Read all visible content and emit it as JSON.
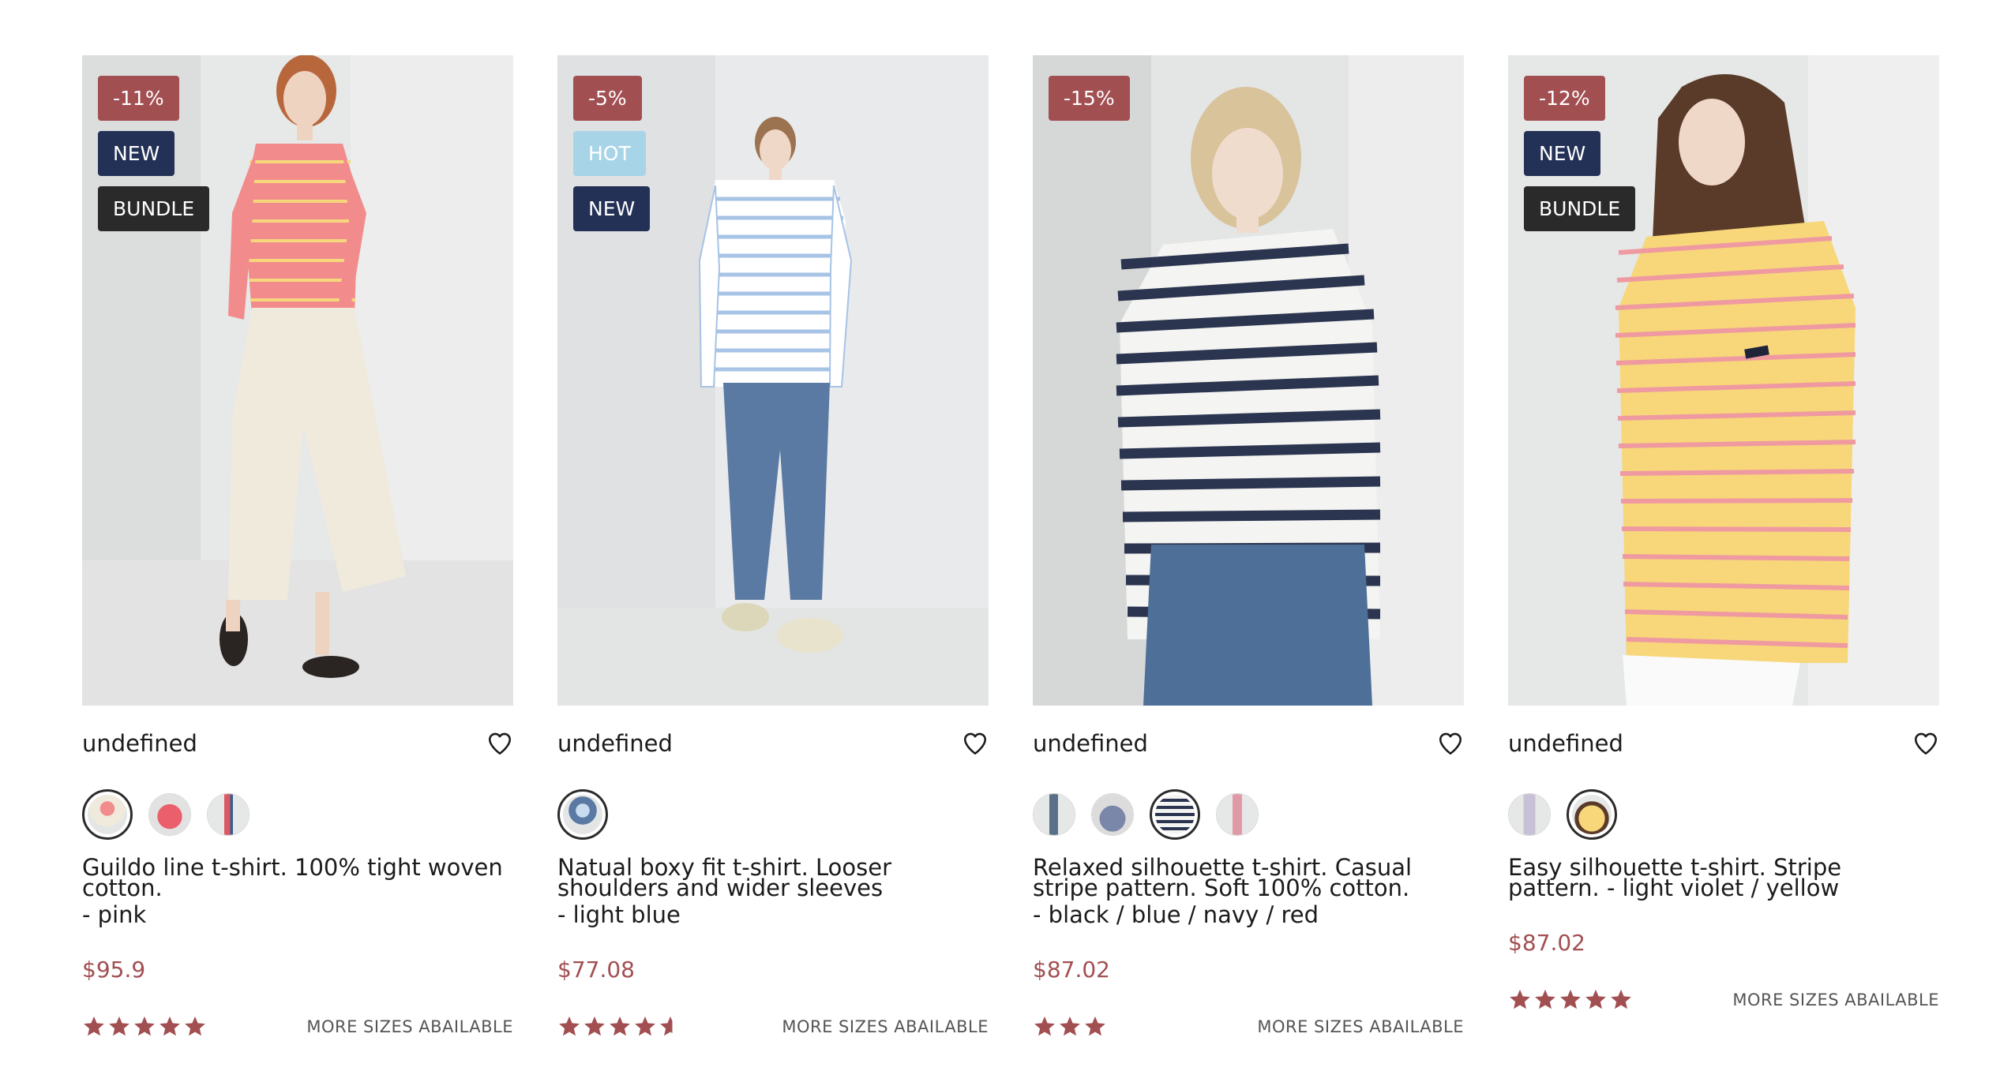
{
  "carousel": {
    "prev_icon": "chevron-left-icon",
    "next_icon": "chevron-right-icon"
  },
  "products": [
    {
      "badges": [
        {
          "type": "discount",
          "text": "-11%"
        },
        {
          "type": "new",
          "text": "NEW"
        },
        {
          "type": "bundle",
          "text": "BUNDLE"
        }
      ],
      "title": "undefined",
      "swatch_count": 3,
      "active_swatch": 0,
      "description": "Guildo line t-shirt. 100% tight woven cotton.",
      "variant": "- pink",
      "price": "$95.9",
      "rating": 5,
      "more_sizes": "MORE SIZES ABAILABLE",
      "shirt_color": "#f28c8c",
      "stripe_color": "#f6d77c"
    },
    {
      "badges": [
        {
          "type": "discount",
          "text": "-5%"
        },
        {
          "type": "hot",
          "text": "HOT"
        },
        {
          "type": "new",
          "text": "NEW"
        }
      ],
      "title": "undefined",
      "swatch_count": 1,
      "active_swatch": 0,
      "description": "Natual boxy fit t-shirt. Looser shoulders and wider sleeves",
      "variant": "- light blue",
      "price": "$77.08",
      "rating": 4.5,
      "more_sizes": "MORE SIZES ABAILABLE",
      "shirt_color": "#ffffff",
      "stripe_color": "#a7c3e6"
    },
    {
      "badges": [
        {
          "type": "discount",
          "text": "-15%"
        }
      ],
      "title": "undefined",
      "swatch_count": 4,
      "active_swatch": 2,
      "description": "Relaxed silhouette t-shirt. Casual stripe pattern. Soft 100% cotton.",
      "variant": "- black / blue / navy / red",
      "price": "$87.02",
      "rating": 3,
      "more_sizes": "MORE SIZES ABAILABLE",
      "shirt_color": "#f4f4f2",
      "stripe_color": "#2c3550"
    },
    {
      "badges": [
        {
          "type": "discount",
          "text": "-12%"
        },
        {
          "type": "new",
          "text": "NEW"
        },
        {
          "type": "bundle",
          "text": "BUNDLE"
        }
      ],
      "title": "undefined",
      "swatch_count": 2,
      "active_swatch": 1,
      "description": "Easy silhouette t-shirt. Stripe pattern. - light violet / yellow",
      "variant": "",
      "price": "$87.02",
      "rating": 5,
      "more_sizes": "MORE SIZES ABAILABLE",
      "shirt_color": "#f7d77a",
      "stripe_color": "#ef9aa0"
    }
  ],
  "colors": {
    "discount": "#a24f52",
    "new": "#243157",
    "hot": "#a8d4e8",
    "bundle": "#2a2a2a",
    "price": "#a24f52",
    "star": "#a24f52"
  }
}
